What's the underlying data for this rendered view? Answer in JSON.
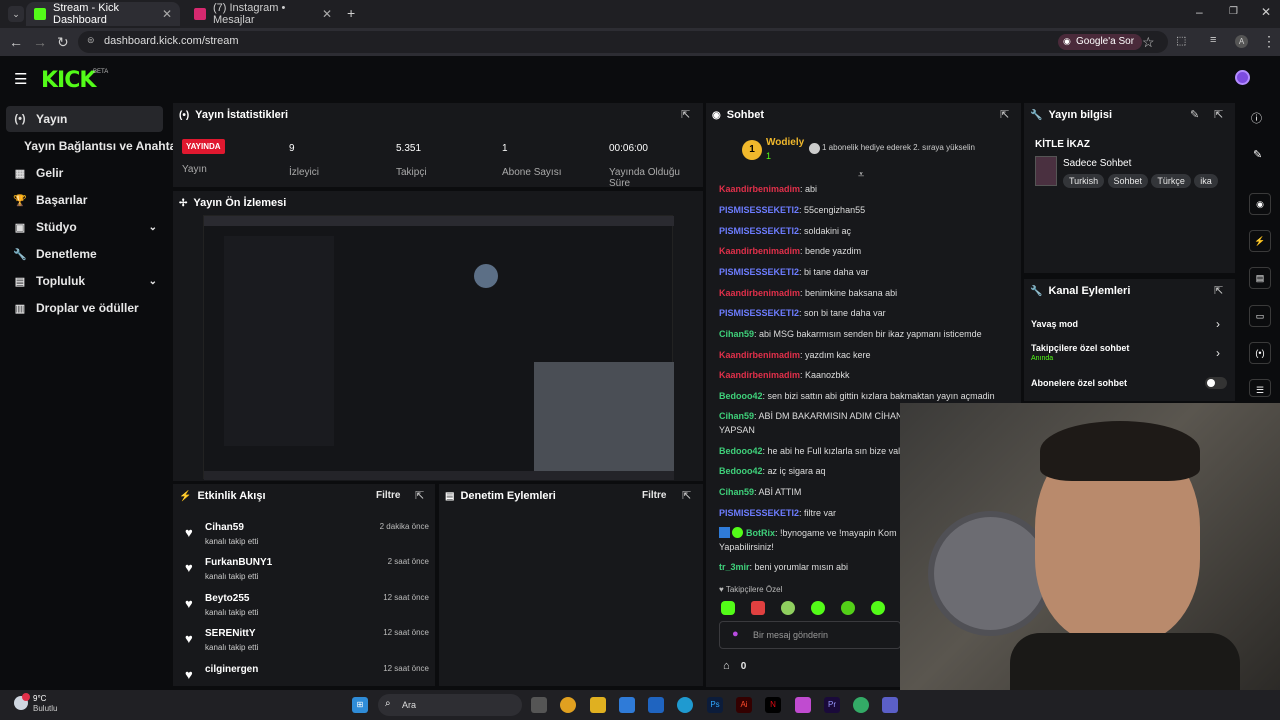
{
  "browser": {
    "tabs": [
      {
        "title": "Stream - Kick Dashboard",
        "active": true
      },
      {
        "title": "(7) Instagram • Mesajlar",
        "active": false
      }
    ],
    "url": "dashboard.kick.com/stream",
    "google_sor": "Google'a Sor"
  },
  "kick": {
    "logo": "KICK",
    "beta": "BETA"
  },
  "sidebar": {
    "items": [
      {
        "label": "Yayın",
        "icon": "broadcast-icon"
      },
      {
        "label": "Yayın Bağlantısı ve Anahtarı",
        "icon": ""
      },
      {
        "label": "Gelir",
        "icon": "money-icon"
      },
      {
        "label": "Başarılar",
        "icon": "trophy-icon"
      },
      {
        "label": "Stüdyo",
        "icon": "studio-icon"
      },
      {
        "label": "Denetleme",
        "icon": "wrench-icon"
      },
      {
        "label": "Topluluk",
        "icon": "community-icon"
      },
      {
        "label": "Droplar ve ödüller",
        "icon": "gift-icon"
      }
    ]
  },
  "stats": {
    "title": "Yayın İstatistikleri",
    "live_badge": "YAYINDA",
    "items": [
      {
        "value": "",
        "label": "Yayın"
      },
      {
        "value": "9",
        "label": "İzleyici"
      },
      {
        "value": "5.351",
        "label": "Takipçi"
      },
      {
        "value": "1",
        "label": "Abone Sayısı"
      },
      {
        "value": "00:06:00",
        "label": "Yayında Olduğu Süre"
      }
    ]
  },
  "preview": {
    "title": "Yayın Ön İzlemesi"
  },
  "activity": {
    "title": "Etkinlik Akışı",
    "filter": "Filtre",
    "items": [
      {
        "name": "Cihan59",
        "action": "kanalı takip etti",
        "time": "2 dakika önce"
      },
      {
        "name": "FurkanBUNY1",
        "action": "kanalı takip etti",
        "time": "2 saat önce"
      },
      {
        "name": "Beyto255",
        "action": "kanalı takip etti",
        "time": "12 saat önce"
      },
      {
        "name": "SERENittY",
        "action": "kanalı takip etti",
        "time": "12 saat önce"
      },
      {
        "name": "cilginergen",
        "action": "",
        "time": "12 saat önce"
      }
    ]
  },
  "moderation": {
    "title": "Denetim Eylemleri",
    "filter": "Filtre"
  },
  "chat": {
    "title": "Sohbet",
    "pinned_user": "Wodiely",
    "pinned_count": "1",
    "pinned_badge": "1",
    "pinned_text": "1 abonelik hediye ederek 2. sıraya yükselin",
    "messages": [
      {
        "user": "Kaandirbenimadim",
        "color": "#e0304a",
        "text": ": abi"
      },
      {
        "user": "PISMISESSEKETI2",
        "color": "#6d7dff",
        "text": ": 55cengizhan55"
      },
      {
        "user": "PISMISESSEKETI2",
        "color": "#6d7dff",
        "text": ": soldakini aç"
      },
      {
        "user": "Kaandirbenimadim",
        "color": "#e0304a",
        "text": ": bende yazdim"
      },
      {
        "user": "PISMISESSEKETI2",
        "color": "#6d7dff",
        "text": ": bi tane daha var"
      },
      {
        "user": "Kaandirbenimadim",
        "color": "#e0304a",
        "text": ": benimkine baksana abi"
      },
      {
        "user": "PISMISESSEKETI2",
        "color": "#6d7dff",
        "text": ": son bi tane daha var"
      },
      {
        "user": "Cihan59",
        "color": "#3fd07a",
        "text": ": abi MSG bakarmısın senden bir ikaz yapmanı isticemde"
      },
      {
        "user": "Kaandirbenimadim",
        "color": "#e0304a",
        "text": ": yazdım kac kere"
      },
      {
        "user": "Kaandirbenimadim",
        "color": "#e0304a",
        "text": ": Kaanozbkk"
      },
      {
        "user": "Bedooo42",
        "color": "#3fd07a",
        "text": ": sen bizi sattın abi gittin kızlara bakmaktan yayın açmadin"
      },
      {
        "user": "Cihan59",
        "color": "#3fd07a",
        "text": ": ABİ DM BAKARMISIN ADIM CİHAN"
      },
      {
        "user": "",
        "color": "#ddd",
        "text": "YAPSAN"
      },
      {
        "user": "Bedooo42",
        "color": "#3fd07a",
        "text": ": he abi he Full kızlarla sın bize val"
      },
      {
        "user": "Bedooo42",
        "color": "#3fd07a",
        "text": ": az iç sigara aq"
      },
      {
        "user": "Cihan59",
        "color": "#3fd07a",
        "text": ": ABİ ATTIM"
      },
      {
        "user": "PISMISESSEKETI2",
        "color": "#6d7dff",
        "text": ": filtre var"
      },
      {
        "user": "BotRix",
        "color": "#3fd07a",
        "text": ": !bynogame ve !mayapin Kom"
      },
      {
        "user": "",
        "color": "#ddd",
        "text": "Yapabilirsiniz!"
      },
      {
        "user": "tr_3mir",
        "color": "#3fd07a",
        "text": ": beni yorumlar mısın abi"
      }
    ],
    "followers_only": "Takipçilere Özel",
    "input_placeholder": "Bir mesaj gönderin",
    "bottom_count": "0"
  },
  "stream_info": {
    "title": "Yayın bilgisi",
    "stream_title": "KİTLE İKAZ",
    "category": "Sadece Sohbet",
    "tags": [
      "Turkish",
      "Sohbet",
      "Türkçe",
      "ika"
    ]
  },
  "channel_actions": {
    "title": "Kanal Eylemleri",
    "items": [
      {
        "label": "Yavaş mod",
        "sub": ""
      },
      {
        "label": "Takipçilere özel sohbet",
        "sub": "Anında"
      },
      {
        "label": "Abonelere özel sohbet",
        "sub": ""
      }
    ]
  },
  "taskbar": {
    "weather_temp": "9°C",
    "weather_desc": "Bulutlu",
    "search": "Ara"
  },
  "colors": {
    "accent": "#53fc18",
    "live": "#e0182f",
    "panel": "#17181b"
  }
}
